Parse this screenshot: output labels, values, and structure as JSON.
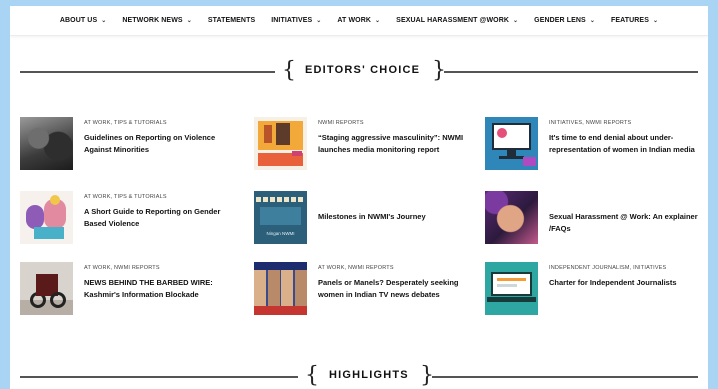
{
  "nav": {
    "items": [
      {
        "label": "ABOUT US",
        "dropdown": true
      },
      {
        "label": "NETWORK NEWS",
        "dropdown": true
      },
      {
        "label": "STATEMENTS",
        "dropdown": false
      },
      {
        "label": "INITIATIVES",
        "dropdown": true
      },
      {
        "label": "AT WORK",
        "dropdown": true
      },
      {
        "label": "SEXUAL HARASSMENT @WORK",
        "dropdown": true
      },
      {
        "label": "GENDER LENS",
        "dropdown": true
      },
      {
        "label": "FEATURES",
        "dropdown": true
      }
    ]
  },
  "editors_choice": {
    "title": "EDITORS' CHOICE"
  },
  "articles": [
    {
      "category": "AT WORK, TIPS & TUTORIALS",
      "title": "Guidelines on Reporting on Violence Against Minorities",
      "thumb": "protest-photo"
    },
    {
      "category": "NWMI REPORTS",
      "title": "“Staging aggressive masculinity”: NWMI launches media monitoring report",
      "thumb": "report-cover"
    },
    {
      "category": "INITIATIVES, NWMI REPORTS",
      "title": "It's time to end denial about under-representation of women in Indian media",
      "thumb": "monitor-illustration"
    },
    {
      "category": "AT WORK, TIPS & TUTORIALS",
      "title": "A Short Guide to Reporting on Gender Based Violence",
      "thumb": "guide-illustration"
    },
    {
      "category": "",
      "title": "Milestones in NWMI's Journey",
      "thumb": "scrabble-photo",
      "caption": "Ningan NWMI"
    },
    {
      "category": "",
      "title": "Sexual Harassment @ Work: An explainer /FAQs",
      "thumb": "face-artwork"
    },
    {
      "category": "AT WORK, NWMI REPORTS",
      "title": "NEWS BEHIND THE BARBED WIRE: Kashmir's Information Blockade",
      "thumb": "motorbike-photo"
    },
    {
      "category": "AT WORK, NWMI REPORTS",
      "title": "Panels or Manels? Desperately seeking women in Indian TV news debates",
      "thumb": "tv-debate-collage"
    },
    {
      "category": "INDEPENDENT JOURNALISM, INITIATIVES",
      "title": "Charter for Independent Journalists",
      "thumb": "laptop-illustration"
    }
  ],
  "highlights": {
    "title": "HIGHLIGHTS"
  }
}
